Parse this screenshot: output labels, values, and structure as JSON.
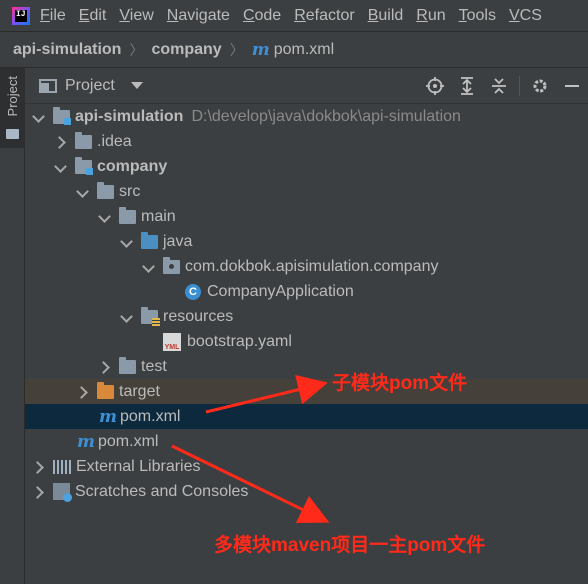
{
  "menu": {
    "items": [
      {
        "ul": "F",
        "rest": "ile"
      },
      {
        "ul": "E",
        "rest": "dit"
      },
      {
        "ul": "V",
        "rest": "iew"
      },
      {
        "ul": "N",
        "rest": "avigate"
      },
      {
        "ul": "C",
        "rest": "ode"
      },
      {
        "ul": "R",
        "rest": "efactor"
      },
      {
        "ul": "B",
        "rest": "uild"
      },
      {
        "ul": "R",
        "rest": "un"
      },
      {
        "ul": "T",
        "rest": "ools"
      },
      {
        "ul": "V",
        "rest": "CS"
      }
    ]
  },
  "app_logo_text": "IJ",
  "breadcrumb": {
    "root": "api-simulation",
    "module": "company",
    "file": "pom.xml",
    "file_icon": "m"
  },
  "toolstrip": {
    "project_tab": "Project"
  },
  "project_header": {
    "title": "Project",
    "tools": [
      "locate-icon",
      "expand-all-icon",
      "collapse-all-icon",
      "gear-icon",
      "hide-icon"
    ]
  },
  "tree": {
    "rows": [
      {
        "name": "api-simulation",
        "bold": true,
        "path": "D:\\develop\\java\\dokbok\\api-simulation",
        "icon": "module-folder"
      },
      {
        "name": ".idea",
        "icon": "folder"
      },
      {
        "name": "company",
        "bold": true,
        "icon": "module-folder"
      },
      {
        "name": "src",
        "icon": "folder"
      },
      {
        "name": "main",
        "icon": "folder"
      },
      {
        "name": "java",
        "icon": "source-folder"
      },
      {
        "name": "com.dokbok.apisimulation.company",
        "icon": "package"
      },
      {
        "name": "CompanyApplication",
        "icon": "class",
        "icon_letter": "C"
      },
      {
        "name": "resources",
        "icon": "resources-folder"
      },
      {
        "name": "bootstrap.yaml",
        "icon": "yaml-file",
        "icon_text": "YML"
      },
      {
        "name": "test",
        "icon": "folder"
      },
      {
        "name": "target",
        "icon": "excluded-folder"
      },
      {
        "name": "pom.xml",
        "icon": "maven-file",
        "icon_text": "m"
      },
      {
        "name": "pom.xml",
        "icon": "maven-file",
        "icon_text": "m"
      },
      {
        "name": "External Libraries",
        "icon": "libraries"
      },
      {
        "name": "Scratches and Consoles",
        "icon": "scratches"
      }
    ]
  },
  "annotations": {
    "submodule": "子模块pom文件",
    "parent": "多模块maven项目一主pom文件",
    "color": "#ff2a1a"
  },
  "colors": {
    "background": "#3c3f41",
    "selected_row": "#0d293e",
    "excluded_row": "#45403a",
    "maven_icon": "#3d8fd6"
  }
}
